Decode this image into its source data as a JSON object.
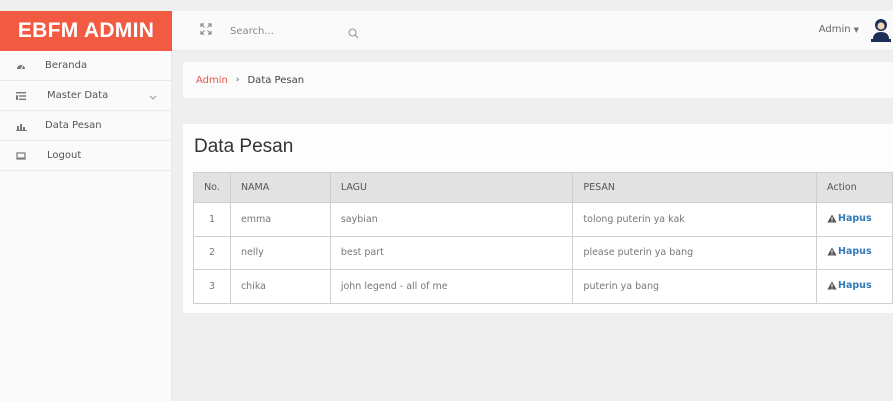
{
  "brand": {
    "title": "EBFM ADMIN",
    "color": "#f25a42"
  },
  "topbar": {
    "expand_icon": "expand-icon",
    "search": {
      "placeholder": "Search...",
      "value": ""
    },
    "user_label": "Admin",
    "avatar_icon": "admin-avatar-icon"
  },
  "sidebar": {
    "items": [
      {
        "label": "Beranda",
        "icon": "dashboard-icon"
      },
      {
        "label": "Master Data",
        "icon": "list-icon",
        "has_dropdown": true
      },
      {
        "label": "Data Pesan",
        "icon": "chart-icon"
      },
      {
        "label": "Logout",
        "icon": "logout-icon"
      }
    ]
  },
  "breadcrumb": {
    "root": "Admin",
    "separator": "›",
    "current": "Data Pesan"
  },
  "main": {
    "title": "Data Pesan",
    "table": {
      "headers": [
        "No.",
        "NAMA",
        "LAGU",
        "PESAN",
        "Action"
      ],
      "rows": [
        {
          "no": "1",
          "nama": "emma",
          "lagu": "saybian",
          "pesan": "tolong puterin ya kak",
          "action": "Hapus"
        },
        {
          "no": "2",
          "nama": "nelly",
          "lagu": "best part",
          "pesan": "please puterin ya bang",
          "action": "Hapus"
        },
        {
          "no": "3",
          "nama": "chika",
          "lagu": "john legend - all of me",
          "pesan": "puterin ya bang",
          "action": "Hapus"
        }
      ]
    }
  },
  "colors": {
    "accent": "#f25a42",
    "link": "#337ab7",
    "breadcrumb_link": "#e2574c"
  }
}
